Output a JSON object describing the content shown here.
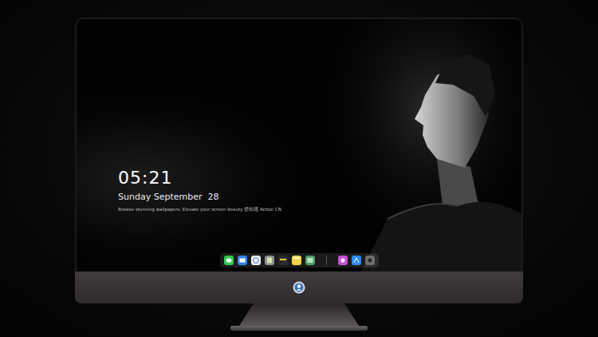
{
  "screen": {
    "clock": {
      "time": "05:21",
      "date": "Sunday September  28",
      "tagline": "Browse stunning wallpapers. Elevate your screen beauty 壁纸嘿 Action CN"
    }
  },
  "dock": {
    "apps": [
      {
        "kind": "messages"
      },
      {
        "kind": "mail"
      },
      {
        "kind": "safari"
      },
      {
        "kind": "files"
      },
      {
        "kind": "video"
      },
      {
        "kind": "notes"
      },
      {
        "kind": "photos"
      }
    ],
    "pinned": [
      {
        "kind": "music"
      },
      {
        "kind": "store"
      },
      {
        "kind": "camera"
      }
    ]
  }
}
